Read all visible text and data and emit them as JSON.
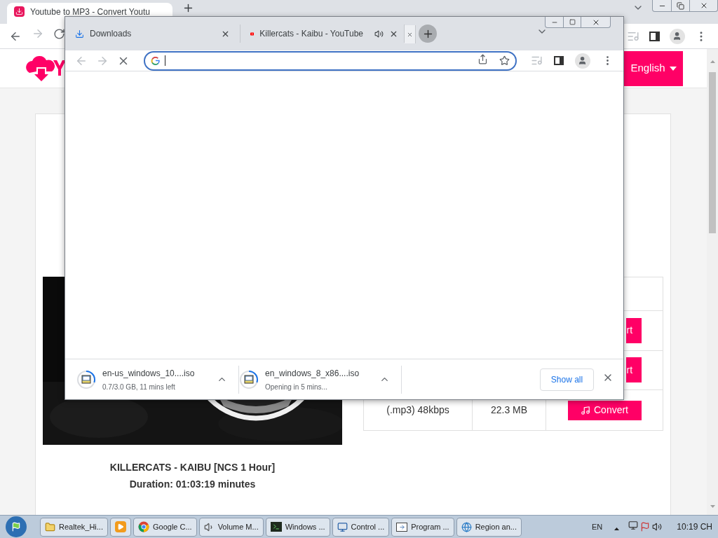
{
  "back_browser": {
    "tabs": [
      {
        "title": "Youtube to MP3 - Convert Youtu",
        "selected": true
      }
    ],
    "page": {
      "language_button": "English",
      "video": {
        "title": "KILLERCATS - KAIBU [NCS 1 Hour]",
        "duration": "Duration: 01:03:19 minutes"
      },
      "table_rows": [
        {
          "kind": "partial",
          "button": "rt"
        },
        {
          "kind": "partial",
          "button": "rt"
        },
        {
          "kind": "full",
          "format": "(.mp3) 48kbps",
          "size": "22.3 MB",
          "button": "Convert"
        }
      ]
    }
  },
  "front_browser": {
    "tabs": [
      {
        "kind": "downloads",
        "title": "Downloads",
        "selected": false
      },
      {
        "kind": "youtube",
        "title": "Killercats - Kaibu - YouTube",
        "audio": true,
        "selected": false
      },
      {
        "kind": "tiny",
        "selected": true
      }
    ],
    "downloads": [
      {
        "name": "en-us_windows_10....iso",
        "status": "0.7/3.0 GB, 11 mins left"
      },
      {
        "name": "en_windows_8_x86....iso",
        "status": "Opening in 5 mins..."
      }
    ],
    "show_all": "Show all"
  },
  "taskbar": {
    "items": [
      {
        "kind": "folder",
        "label": "Realtek_Hi..."
      },
      {
        "kind": "media"
      },
      {
        "kind": "chrome",
        "label": "Google C..."
      },
      {
        "kind": "volume",
        "label": "Volume M..."
      },
      {
        "kind": "terminal",
        "label": "Windows ..."
      },
      {
        "kind": "control",
        "label": "Control ..."
      },
      {
        "kind": "program",
        "label": "Program ..."
      },
      {
        "kind": "globe",
        "label": "Region an..."
      }
    ],
    "language": "EN",
    "clock": "10:19 CH"
  }
}
